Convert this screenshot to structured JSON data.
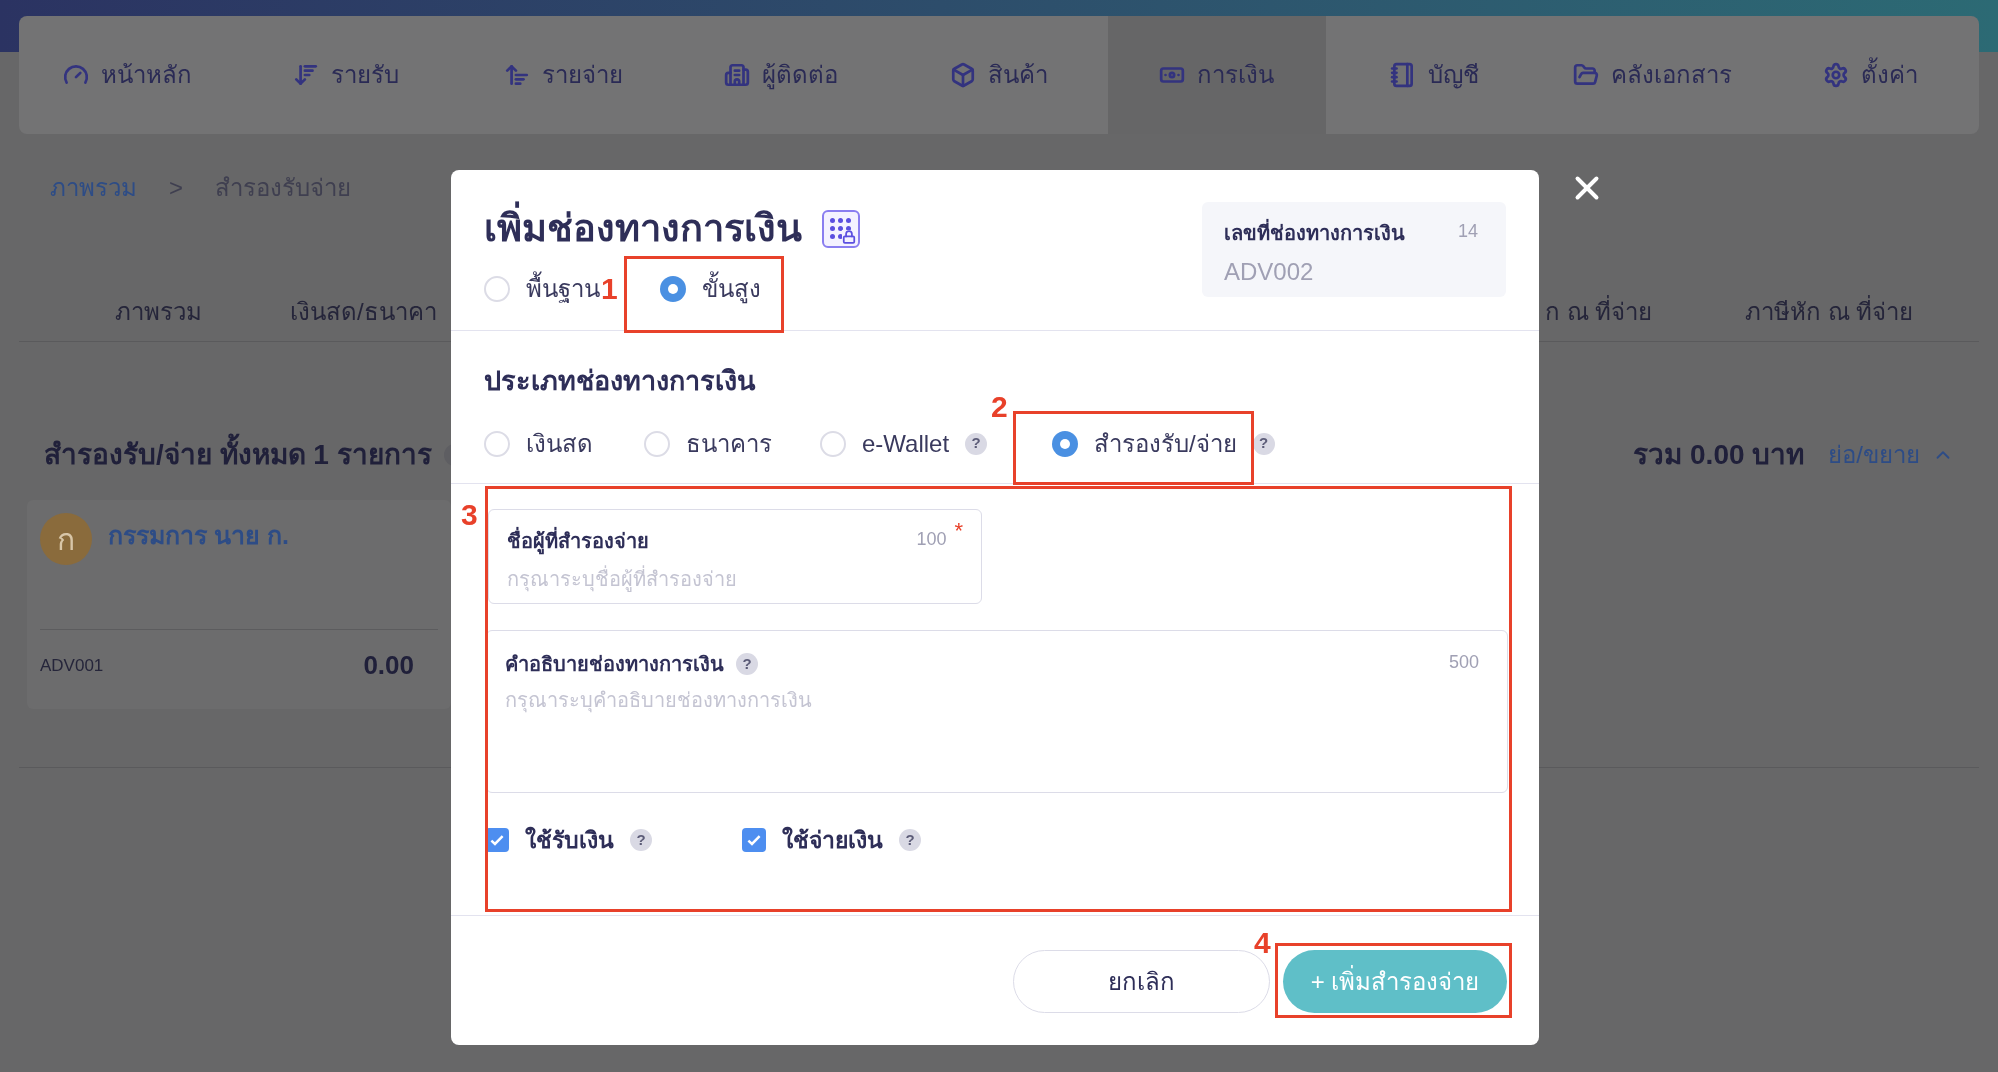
{
  "nav": [
    {
      "label": "หน้าหลัก",
      "selected": false
    },
    {
      "label": "รายรับ",
      "selected": false
    },
    {
      "label": "รายจ่าย",
      "selected": false
    },
    {
      "label": "ผู้ติดต่อ",
      "selected": false
    },
    {
      "label": "สินค้า",
      "selected": false
    },
    {
      "label": "การเงิน",
      "selected": true
    },
    {
      "label": "บัญชี",
      "selected": false
    },
    {
      "label": "คลังเอกสาร",
      "selected": false
    },
    {
      "label": "ตั้งค่า",
      "selected": false
    }
  ],
  "breadcrumb": {
    "link": "ภาพรวม",
    "separator": ">",
    "current": "สำรองรับจ่าย"
  },
  "page_tabs": [
    "ภาพรวม",
    "เงินสด/ธนาคา",
    "ก ณ ที่จ่าย",
    "ภาษีหัก ณ ที่จ่าย"
  ],
  "list_header": {
    "title": "สำรองรับ/จ่าย ทั้งหมด 1 รายการ",
    "total": "รวม 0.00 บาท",
    "toggle": "ย่อ/ขยาย"
  },
  "card": {
    "avatar": "ก",
    "name": "กรรมการ นาย ก.",
    "code": "ADV001",
    "amount": "0.00"
  },
  "modal": {
    "title": "เพิ่มช่องทางการเงิน",
    "mode_options": [
      {
        "label": "พื้นฐาน",
        "selected": false
      },
      {
        "label": "ขั้นสูง",
        "selected": true
      }
    ],
    "id_box": {
      "label": "เลขที่ช่องทางการเงิน",
      "count": "14",
      "value": "ADV002"
    },
    "type_title": "ประเภทช่องทางการเงิน",
    "type_options": [
      {
        "label": "เงินสด",
        "selected": false
      },
      {
        "label": "ธนาคาร",
        "selected": false
      },
      {
        "label": "e-Wallet",
        "selected": false,
        "help": "?"
      },
      {
        "label": "สำรองรับ/จ่าย",
        "selected": true,
        "help": "?"
      }
    ],
    "name_field": {
      "label": "ชื่อผู้ที่สำรองจ่าย",
      "limit": "100",
      "required_mark": "*",
      "placeholder": "กรุณาระบุชื่อผู้ที่สำรองจ่าย"
    },
    "description_field": {
      "label": "คำอธิบายช่องทางการเงิน",
      "help": "?",
      "limit": "500",
      "placeholder": "กรุณาระบุคำอธิบายช่องทางการเงิน"
    },
    "checkboxes": [
      {
        "label": "ใช้รับเงิน",
        "checked": true,
        "help": "?"
      },
      {
        "label": "ใช้จ่ายเงิน",
        "checked": true,
        "help": "?"
      }
    ],
    "cancel_button": "ยกเลิก",
    "submit_button": "+ เพิ่มสำรองจ่าย"
  },
  "annotations": [
    "1",
    "2",
    "3",
    "4"
  ]
}
